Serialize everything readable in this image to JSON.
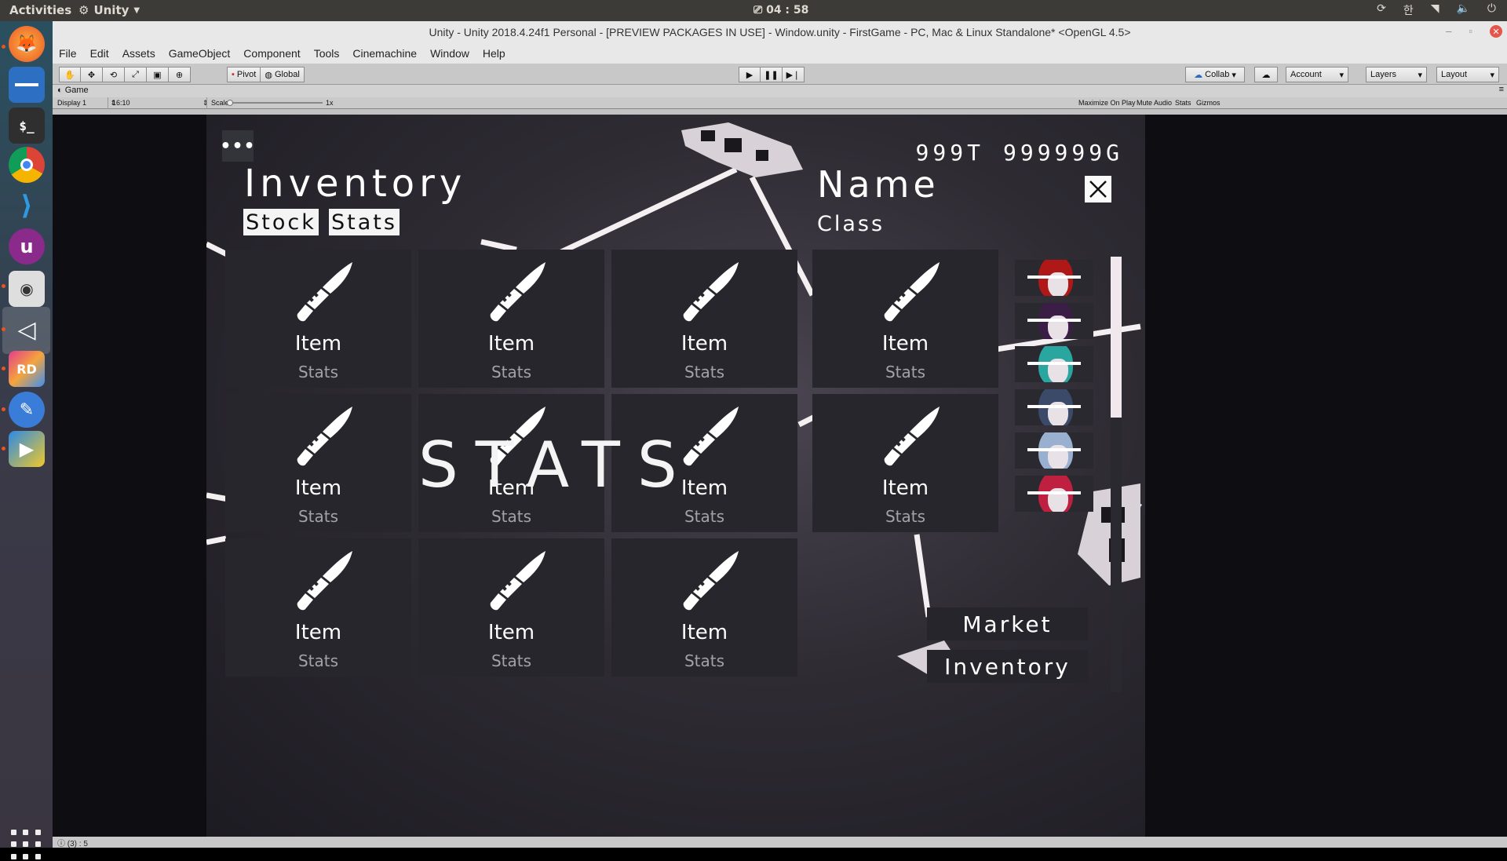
{
  "desktop": {
    "activities": "Activities",
    "app_menu": "Unity",
    "clock": "04 : 58",
    "tray_input": "한"
  },
  "window": {
    "title": "Unity - Unity 2018.4.24f1 Personal - [PREVIEW PACKAGES IN USE] - Window.unity - FirstGame - PC, Mac & Linux Standalone* <OpenGL 4.5>"
  },
  "menubar": [
    "File",
    "Edit",
    "Assets",
    "GameObject",
    "Component",
    "Tools",
    "Cinemachine",
    "Window",
    "Help"
  ],
  "toolbar": {
    "pivot": "Pivot",
    "global": "Global",
    "collab": "Collab",
    "account": "Account",
    "layers": "Layers",
    "layout": "Layout"
  },
  "game_tab": {
    "label": "Game",
    "display": "Display 1",
    "aspect": "16:10",
    "scale_label": "Scale",
    "scale_value": "1x",
    "maximize": "Maximize On Play",
    "mute": "Mute Audio",
    "stats": "Stats",
    "gizmos": "Gizmos"
  },
  "status": {
    "text": "(3) : 5"
  },
  "game": {
    "menu_dots": "•••",
    "inventory_title": "Inventory",
    "tab_stock": "Stock",
    "tab_stats": "Stats",
    "currency_t": "999T",
    "currency_g": "999999G",
    "char_name": "Name",
    "char_class": "Class",
    "overlay_text": "STATS",
    "items": [
      {
        "label": "Item",
        "sub": "Stats"
      },
      {
        "label": "Item",
        "sub": "Stats"
      },
      {
        "label": "Item",
        "sub": "Stats"
      },
      {
        "label": "Item",
        "sub": "Stats"
      },
      {
        "label": "Item",
        "sub": "Stats"
      },
      {
        "label": "Item",
        "sub": "Stats"
      },
      {
        "label": "Item",
        "sub": "Stats"
      },
      {
        "label": "Item",
        "sub": "Stats"
      },
      {
        "label": "Item",
        "sub": "Stats"
      },
      {
        "label": "Item",
        "sub": "Stats"
      },
      {
        "label": "Item",
        "sub": "Stats"
      }
    ],
    "market_button": "Market",
    "inventory_button": "Inventory",
    "portrait_hair_colors": [
      "#b01818",
      "#3a1e45",
      "#2aa6a0",
      "#3c4a6a",
      "#9ab0d0",
      "#c02040"
    ]
  }
}
